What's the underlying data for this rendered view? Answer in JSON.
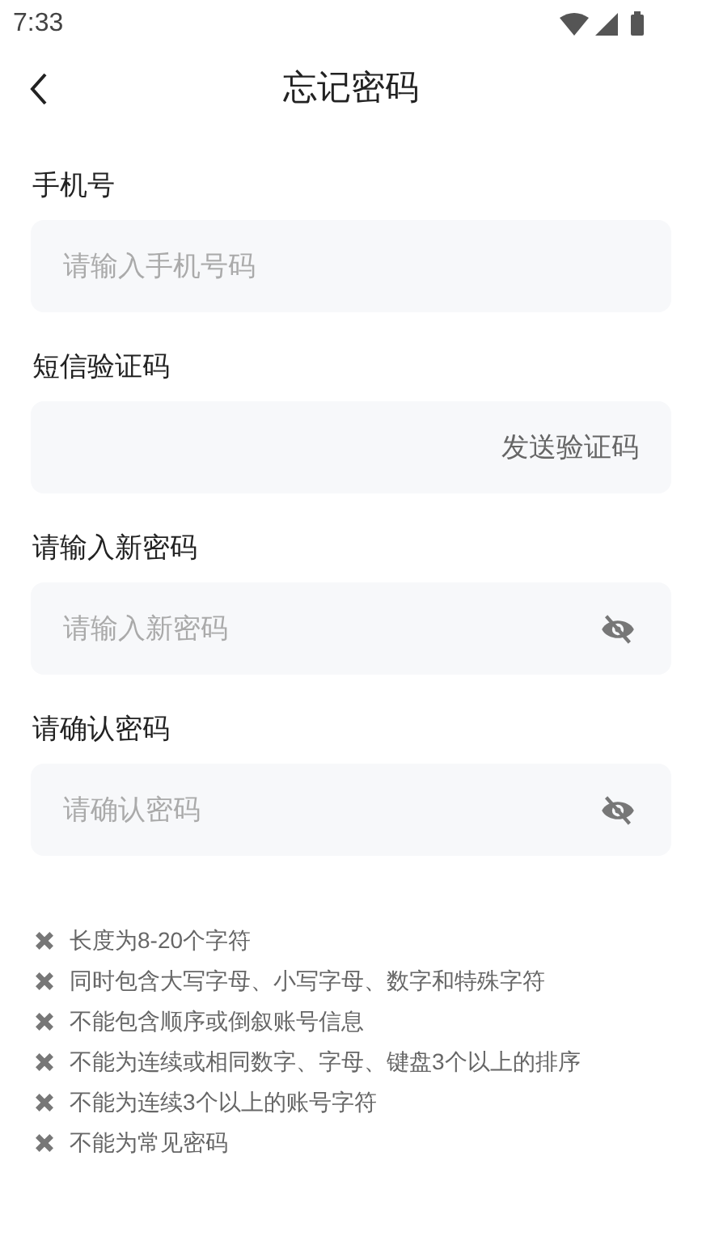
{
  "status_bar": {
    "time": "7:33"
  },
  "header": {
    "title": "忘记密码"
  },
  "fields": [
    {
      "kind": "text",
      "label": "手机号",
      "placeholder": "请输入手机号码"
    },
    {
      "kind": "code",
      "label": "短信验证码",
      "action": "发送验证码"
    },
    {
      "kind": "password",
      "label": "请输入新密码",
      "placeholder": "请输入新密码",
      "visible": false
    },
    {
      "kind": "password",
      "label": "请确认密码",
      "placeholder": "请确认密码",
      "visible": false
    }
  ],
  "rules": [
    {
      "text": "长度为8-20个字符",
      "met": false
    },
    {
      "text": "同时包含大写字母、小写字母、数字和特殊字符",
      "met": false
    },
    {
      "text": "不能包含顺序或倒叙账号信息",
      "met": false
    },
    {
      "text": "不能为连续或相同数字、字母、键盘3个以上的排序",
      "met": false
    },
    {
      "text": "不能为连续3个以上的账号字符",
      "met": false
    },
    {
      "text": "不能为常见密码",
      "met": false
    }
  ]
}
